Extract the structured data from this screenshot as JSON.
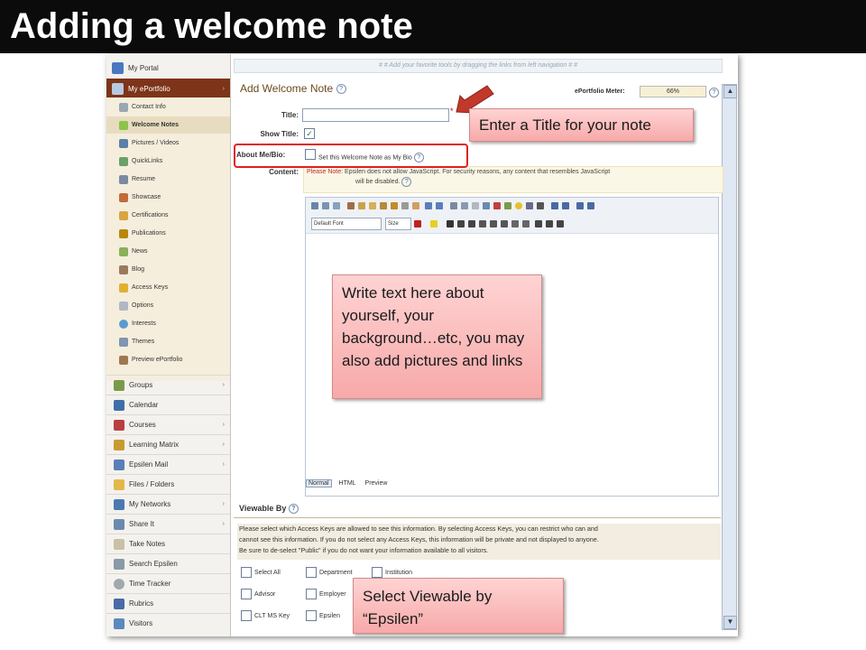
{
  "slide": {
    "title": "Adding a welcome note"
  },
  "sidebar": {
    "top_items": [
      "My Portal",
      "My ePortfolio"
    ],
    "subitems": [
      "Contact Info",
      "Welcome Notes",
      "Pictures / Videos",
      "QuickLinks",
      "Resume",
      "Showcase",
      "Certifications",
      "Publications",
      "News",
      "Blog",
      "Access Keys",
      "Options",
      "Interests",
      "Themes",
      "Preview ePortfolio"
    ],
    "items": [
      "Groups",
      "Calendar",
      "Courses",
      "Learning Matrix",
      "Epsilen Mail",
      "Files / Folders",
      "My Networks",
      "Share It",
      "Take Notes",
      "Search Epsilen",
      "Time Tracker",
      "Rubrics",
      "Visitors"
    ],
    "arrow": "›"
  },
  "main": {
    "hint": "# # Add your favorite tools by dragging the links from left navigation # #",
    "panel_title": "Add Welcome Note",
    "help_glyph": "?",
    "meter_label": "ePortfolio Meter:",
    "meter_value": "66%",
    "labels": {
      "title": "Title:",
      "show_title": "Show Title:",
      "about": "About Me/Bio:",
      "content": "Content:"
    },
    "required": "*",
    "show_title_check": "✓",
    "bio_text": "Set this Welcome Note as My Bio",
    "note_prefix": "Please Note:",
    "note_text": "Epsilen does not allow JavaScript. For security reasons, any content that resembles JavaScript",
    "note_text2": "will be disabled.",
    "font_select": "Default Font",
    "size_select": "Size",
    "modes": [
      "Normal",
      "HTML",
      "Preview"
    ],
    "viewable_title": "Viewable By",
    "viewable_desc1": "Please select which Access Keys are allowed to see this information. By selecting Access Keys, you can restrict who can and",
    "viewable_desc2": "cannot see this information. If you do not select any Access Keys, this information will be private and not displayed to anyone.",
    "viewable_desc3": "Be sure to de-select \"Public\" if you do not want your information available to all visitors.",
    "options": [
      "Select All",
      "Department",
      "Institution",
      "Advisor",
      "Employer",
      "CLT MS Key",
      "Epsilen"
    ],
    "scroll_up": "▲",
    "scroll_down": "▼"
  },
  "callouts": {
    "title": "Enter a Title for your note",
    "content": "Write text here about yourself, your background…etc, you may also add pictures and links",
    "viewable": "Select Viewable by “Epsilen”"
  }
}
